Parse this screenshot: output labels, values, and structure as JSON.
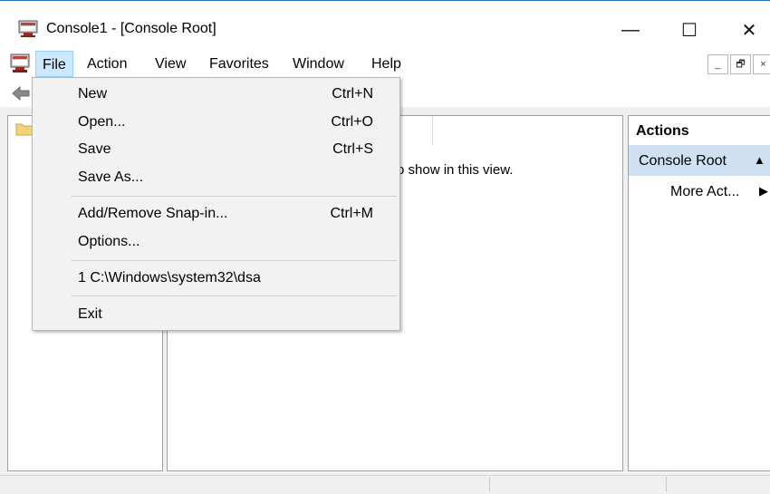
{
  "window": {
    "title": "Console1 - [Console Root]",
    "minimize_glyph": "—",
    "maximize_glyph": "☐",
    "close_glyph": "✕"
  },
  "menubar": {
    "items": [
      "File",
      "Action",
      "View",
      "Favorites",
      "Window",
      "Help"
    ]
  },
  "mdi": {
    "minimize": "_",
    "restore": "🗗",
    "close": "×"
  },
  "file_menu": {
    "items": [
      {
        "label": "New",
        "shortcut": "Ctrl+N"
      },
      {
        "label": "Open...",
        "shortcut": "Ctrl+O"
      },
      {
        "label": "Save",
        "shortcut": "Ctrl+S"
      },
      {
        "label": "Save As...",
        "shortcut": ""
      },
      {
        "label": "Add/Remove Snap-in...",
        "shortcut": "Ctrl+M"
      },
      {
        "label": "Options...",
        "shortcut": ""
      },
      {
        "label": "1 C:\\Windows\\system32\\dsa",
        "shortcut": ""
      },
      {
        "label": "Exit",
        "shortcut": ""
      }
    ]
  },
  "result": {
    "empty_text": "o show in this view."
  },
  "actions": {
    "title": "Actions",
    "root_label": "Console Root",
    "more_actions": "More Act..."
  },
  "icons": {
    "app": "mmc-console-icon",
    "menu": "mmc-console-icon",
    "back": "back-arrow-icon",
    "tree_root": "folder-icon"
  },
  "colors": {
    "menu_highlight": "#cce8ff",
    "actions_selected": "#cfe0f3",
    "title_border": "#1e79b7"
  }
}
